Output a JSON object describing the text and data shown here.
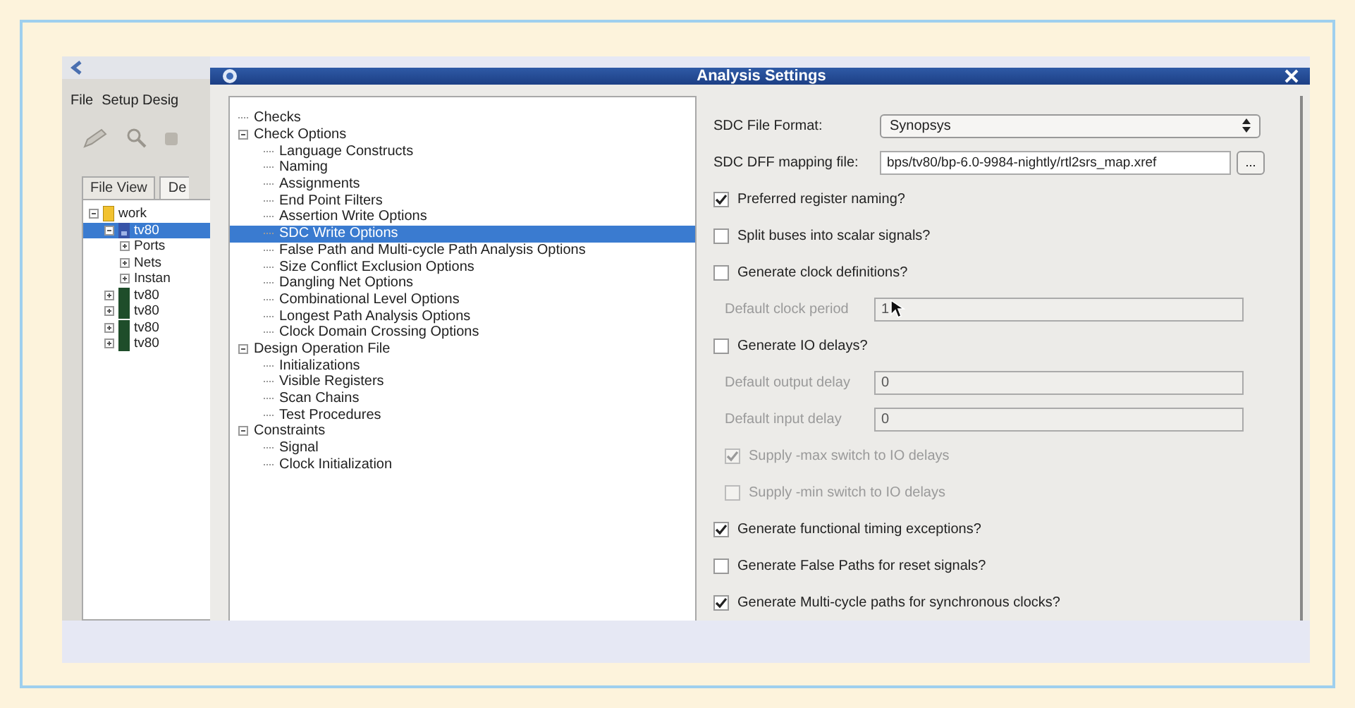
{
  "back_window": {
    "menu": [
      "File",
      "Setup Desig"
    ],
    "tabs": [
      {
        "label": "File View",
        "selected": false
      },
      {
        "label": "De",
        "selected": true
      }
    ],
    "tree": [
      {
        "label": "work",
        "kind": "folder",
        "expanded": true,
        "selected": false,
        "children": [
          {
            "label": "tv80",
            "kind": "design",
            "expanded": true,
            "selected": true,
            "children": [
              {
                "label": "Ports",
                "expanded": false,
                "selected": false
              },
              {
                "label": "Nets",
                "expanded": false,
                "selected": false
              },
              {
                "label": "Instan",
                "expanded": false,
                "selected": false
              }
            ]
          },
          {
            "label": "tv80",
            "kind": "block",
            "expanded": false,
            "selected": false
          },
          {
            "label": "tv80",
            "kind": "block",
            "expanded": false,
            "selected": false
          },
          {
            "label": "tv80",
            "kind": "block",
            "expanded": false,
            "selected": false
          },
          {
            "label": "tv80",
            "kind": "block",
            "expanded": false,
            "selected": false
          }
        ]
      }
    ]
  },
  "dialog": {
    "title": "Analysis Settings",
    "tree": [
      {
        "label": "Checks",
        "selected": false
      },
      {
        "label": "Check Options",
        "expanded": true,
        "selected": false,
        "children": [
          {
            "label": "Language Constructs",
            "selected": false
          },
          {
            "label": "Naming",
            "selected": false
          },
          {
            "label": "Assignments",
            "selected": false
          },
          {
            "label": "End Point Filters",
            "selected": false
          },
          {
            "label": "Assertion Write Options",
            "selected": false
          },
          {
            "label": "SDC Write Options",
            "selected": true
          },
          {
            "label": "False Path and Multi-cycle Path Analysis Options",
            "selected": false
          },
          {
            "label": "Size Conflict Exclusion Options",
            "selected": false
          },
          {
            "label": "Dangling Net Options",
            "selected": false
          },
          {
            "label": "Combinational Level Options",
            "selected": false
          },
          {
            "label": "Longest Path Analysis Options",
            "selected": false
          },
          {
            "label": "Clock Domain Crossing Options",
            "selected": false
          }
        ]
      },
      {
        "label": "Design Operation File",
        "expanded": true,
        "selected": false,
        "children": [
          {
            "label": "Initializations",
            "selected": false
          },
          {
            "label": "Visible Registers",
            "selected": false
          },
          {
            "label": "Scan Chains",
            "selected": false
          },
          {
            "label": "Test Procedures",
            "selected": false
          }
        ]
      },
      {
        "label": "Constraints",
        "expanded": true,
        "selected": false,
        "children": [
          {
            "label": "Signal",
            "selected": false
          },
          {
            "label": "Clock Initialization",
            "selected": false
          }
        ]
      }
    ],
    "settings": [
      {
        "kind": "select",
        "label": "SDC File Format:",
        "value": "Synopsys"
      },
      {
        "kind": "file",
        "label": "SDC DFF mapping file:",
        "value": "bps/tv80/bp-6.0-9984-nightly/rtl2srs_map.xref",
        "button": "..."
      },
      {
        "kind": "checkbox",
        "label": "Preferred register naming?",
        "checked": true,
        "disabled": false
      },
      {
        "kind": "checkbox",
        "label": "Split buses into scalar signals?",
        "checked": false,
        "disabled": false
      },
      {
        "kind": "checkbox",
        "label": "Generate clock definitions?",
        "checked": false,
        "disabled": false,
        "children": [
          {
            "kind": "field",
            "label": "Default clock period",
            "value": "1",
            "disabled": true,
            "pointer": true
          }
        ]
      },
      {
        "kind": "checkbox",
        "label": "Generate IO delays?",
        "checked": false,
        "disabled": false,
        "children": [
          {
            "kind": "field",
            "label": "Default output delay",
            "value": "0",
            "disabled": true
          },
          {
            "kind": "field",
            "label": "Default input delay",
            "value": "0",
            "disabled": true
          },
          {
            "kind": "checkbox",
            "label": "Supply -max switch to IO delays",
            "checked": true,
            "disabled": true
          },
          {
            "kind": "checkbox",
            "label": "Supply -min switch to IO delays",
            "checked": false,
            "disabled": true
          }
        ]
      },
      {
        "kind": "checkbox",
        "label": "Generate functional timing exceptions?",
        "checked": true,
        "disabled": false
      },
      {
        "kind": "checkbox",
        "label": "Generate False Paths for reset signals?",
        "checked": false,
        "disabled": false
      },
      {
        "kind": "checkbox",
        "label": "Generate Multi-cycle paths for synchronous clocks?",
        "checked": true,
        "disabled": false
      }
    ]
  }
}
